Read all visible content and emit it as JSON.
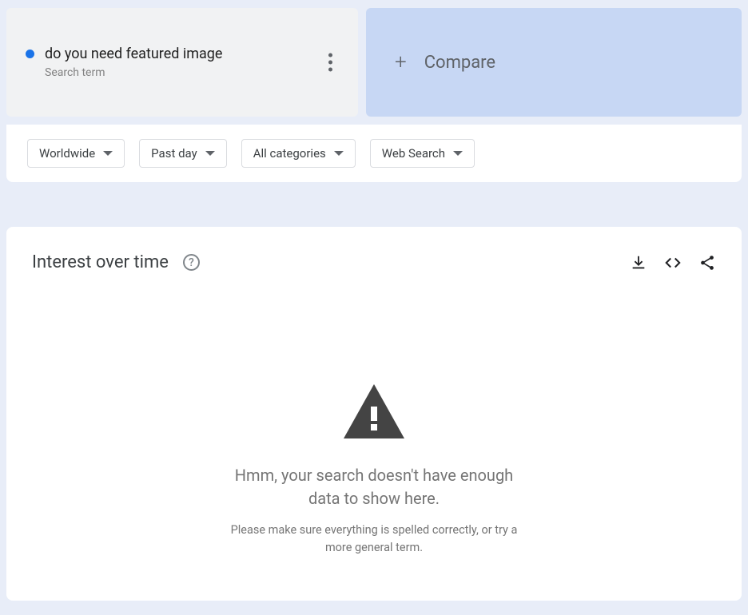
{
  "search_term": {
    "title": "do you need featured image",
    "subtitle": "Search term"
  },
  "compare": {
    "label": "Compare"
  },
  "filters": {
    "region": "Worldwide",
    "time": "Past day",
    "category": "All categories",
    "search_type": "Web Search"
  },
  "chart": {
    "title": "Interest over time",
    "empty_heading": "Hmm, your search doesn't have enough data to show here.",
    "empty_subtext": "Please make sure everything is spelled correctly, or try a more general term."
  }
}
